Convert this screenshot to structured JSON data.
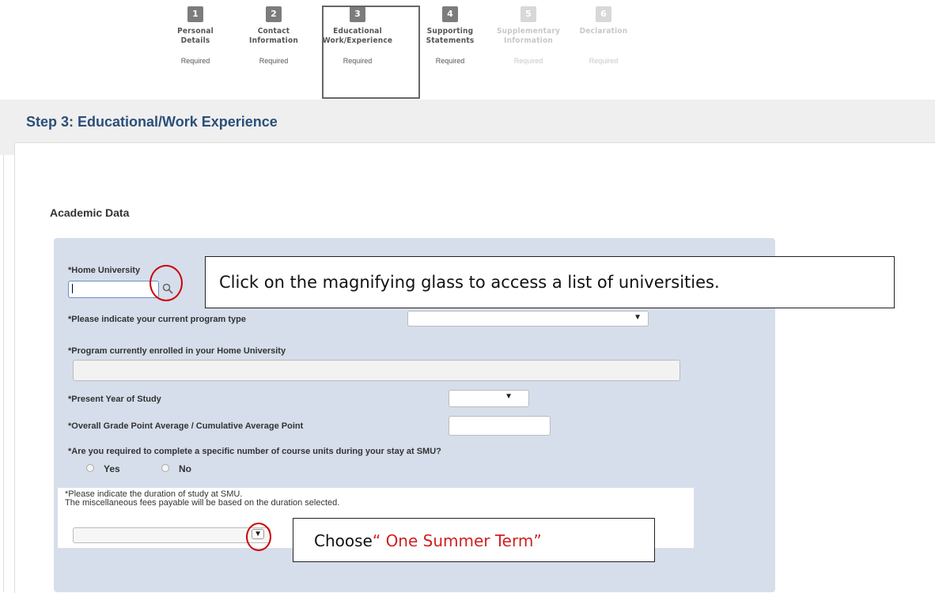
{
  "steps": [
    {
      "number": "1",
      "label_line1": "Personal",
      "label_line2": "Details",
      "status": "Required",
      "state": "done"
    },
    {
      "number": "2",
      "label_line1": "Contact",
      "label_line2": "Information",
      "status": "Required",
      "state": "done"
    },
    {
      "number": "3",
      "label_line1": "Educational",
      "label_line2": "Work/Experience",
      "status": "Required",
      "state": "active"
    },
    {
      "number": "4",
      "label_line1": "Supporting",
      "label_line2": "Statements",
      "status": "Required",
      "state": "done"
    },
    {
      "number": "5",
      "label_line1": "Supplementary",
      "label_line2": "Information",
      "status": "Required",
      "state": "disabled"
    },
    {
      "number": "6",
      "label_line1": "Declaration",
      "label_line2": "",
      "status": "Required",
      "state": "disabled"
    }
  ],
  "page": {
    "title": "Step 3: Educational/Work Experience",
    "section_title": "Academic Data"
  },
  "form": {
    "home_university": {
      "label": "*Home University",
      "value": ""
    },
    "program_type": {
      "label": "*Please indicate your current program type",
      "selected": ""
    },
    "program_enrolled": {
      "label": "*Program currently enrolled in your Home University",
      "value": ""
    },
    "year_of_study": {
      "label": "*Present Year of Study",
      "selected": ""
    },
    "gpa": {
      "label": "*Overall Grade Point Average / Cumulative Average Point",
      "value": ""
    },
    "course_units": {
      "label": "*Are you required to complete a specific number of course units during your stay at SMU?",
      "options": [
        "Yes",
        "No"
      ]
    },
    "duration": {
      "label_line1": "*Please indicate the duration of study at SMU.",
      "label_line2": "The miscellaneous fees payable will be based on the duration selected.",
      "selected": ""
    }
  },
  "annotations": {
    "callout_search": "Click on the magnifying glass to access a list of universities.",
    "callout_choose_prefix": "Choose",
    "callout_choose_value": "“ One Summer Term”"
  },
  "icons": {
    "search": "magnifier-icon",
    "dropdown": "triangle-down-icon"
  },
  "colors": {
    "title": "#2b4f7a",
    "panel": "#d6deeb",
    "annotation_red": "#d21f1f"
  }
}
